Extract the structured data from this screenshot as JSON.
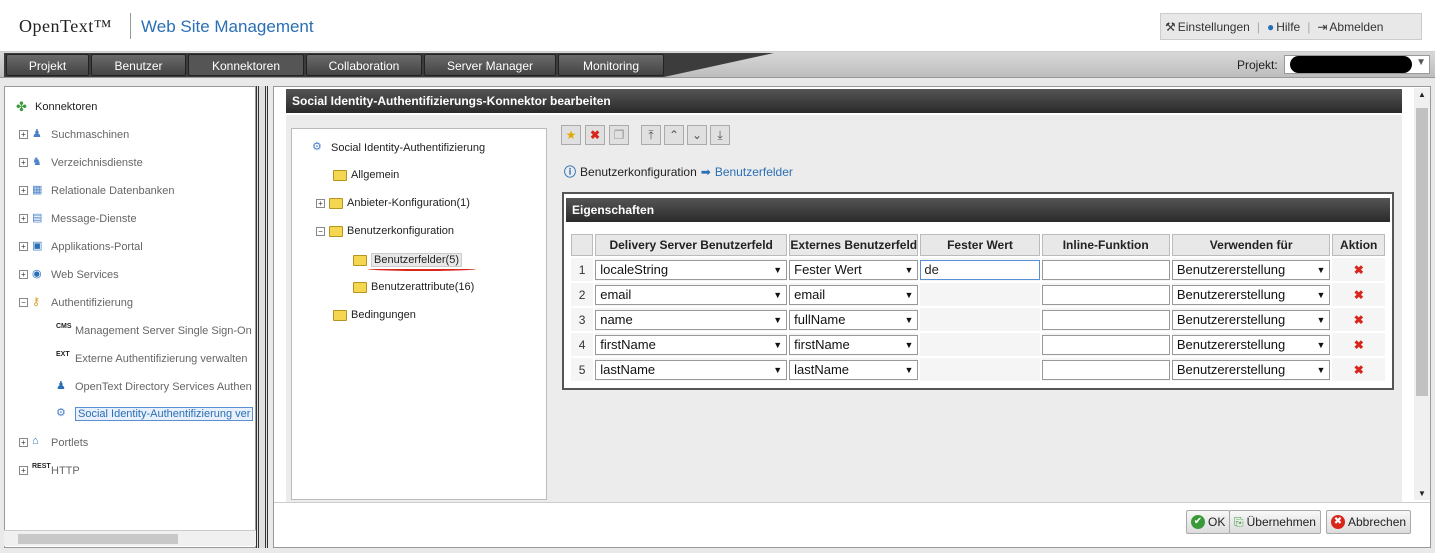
{
  "header": {
    "brand": "OpenText™",
    "app_title": "Web Site Management",
    "settings_label": "Einstellungen",
    "help_label": "Hilfe",
    "logout_label": "Abmelden"
  },
  "nav": {
    "tabs": [
      "Projekt",
      "Benutzer",
      "Konnektoren",
      "Collaboration",
      "Server Manager",
      "Monitoring"
    ],
    "project_label": "Projekt:"
  },
  "left_tree": {
    "root": "Konnektoren",
    "items": [
      "Suchmaschinen",
      "Verzeichnisdienste",
      "Relationale Datenbanken",
      "Message-Dienste",
      "Applikations-Portal",
      "Web Services",
      "Authentifizierung",
      "Management Server Single Sign-On",
      "Externe Authentifizierung verwalten",
      "OpenText Directory Services Authen",
      "Social Identity-Authentifizierung ver",
      "Portlets",
      "HTTP"
    ],
    "icon_badges": {
      "cms": "CMS",
      "ext": "EXT",
      "rest": "REST"
    }
  },
  "editor": {
    "title": "Social Identity-Authentifizierungs-Konnektor bearbeiten",
    "tree": {
      "root": "Social Identity-Authentifizierung",
      "general": "Allgemein",
      "provider": "Anbieter-Konfiguration(1)",
      "user_config": "Benutzerkonfiguration",
      "user_fields": "Benutzerfelder(5)",
      "user_attributes": "Benutzerattribute(16)",
      "conditions": "Bedingungen"
    },
    "breadcrumb": {
      "parent": "Benutzerkonfiguration",
      "current": "Benutzerfelder"
    },
    "properties_title": "Eigenschaften",
    "columns": [
      "Delivery Server Benutzerfeld",
      "Externes Benutzerfeld",
      "Fester Wert",
      "Inline-Funktion",
      "Verwenden für",
      "Aktion"
    ],
    "rows": [
      {
        "num": "1",
        "ds_field": "localeString",
        "ext_field": "Fester Wert",
        "fixed_value": "de",
        "inline": "",
        "use_for": "Benutzererstellung"
      },
      {
        "num": "2",
        "ds_field": "email",
        "ext_field": "email",
        "fixed_value": "",
        "inline": "",
        "use_for": "Benutzererstellung"
      },
      {
        "num": "3",
        "ds_field": "name",
        "ext_field": "fullName",
        "fixed_value": "",
        "inline": "",
        "use_for": "Benutzererstellung"
      },
      {
        "num": "4",
        "ds_field": "firstName",
        "ext_field": "firstName",
        "fixed_value": "",
        "inline": "",
        "use_for": "Benutzererstellung"
      },
      {
        "num": "5",
        "ds_field": "lastName",
        "ext_field": "lastName",
        "fixed_value": "",
        "inline": "",
        "use_for": "Benutzererstellung"
      }
    ]
  },
  "footer": {
    "ok": "OK",
    "apply": "Übernehmen",
    "cancel": "Abbrechen"
  }
}
